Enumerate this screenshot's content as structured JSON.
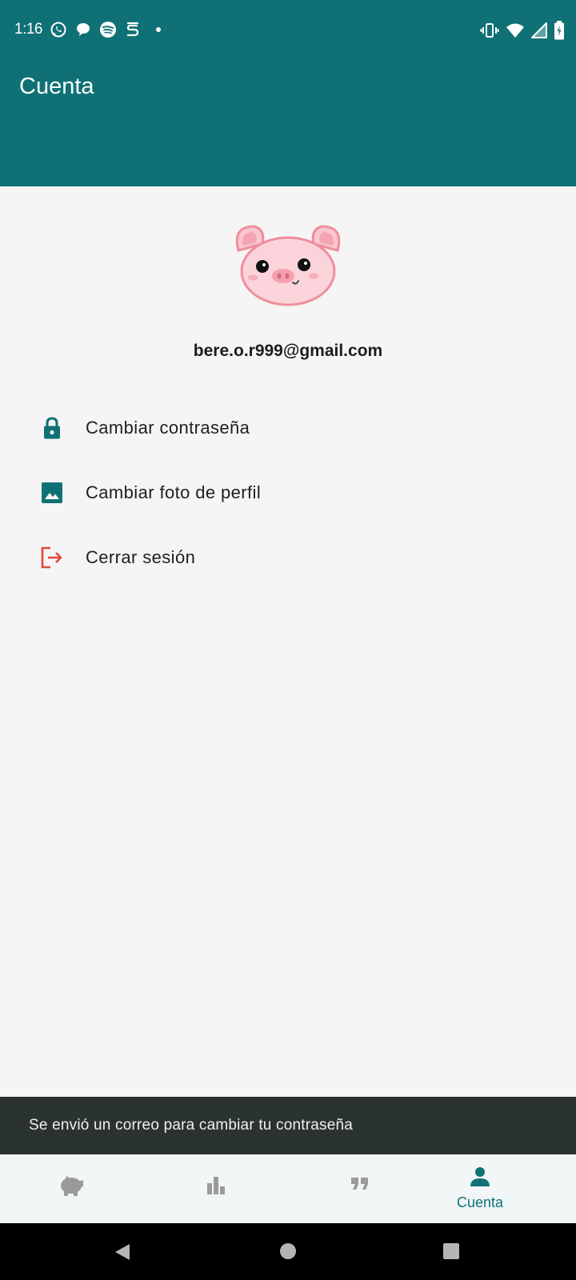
{
  "status_bar": {
    "time": "1:16",
    "left_icons": [
      "whatsapp-icon",
      "chat-bubble-icon",
      "spotify-icon",
      "s-app-icon",
      "dot-icon"
    ],
    "right_icons": [
      "vibrate-icon",
      "wifi-icon",
      "signal-icon",
      "battery-icon"
    ]
  },
  "app_bar": {
    "title": "Cuenta"
  },
  "profile": {
    "avatar_icon": "pig-avatar-icon",
    "email": "bere.o.r999@gmail.com"
  },
  "menu": {
    "items": [
      {
        "label": "Cambiar contraseña",
        "icon": "lock-icon"
      },
      {
        "label": "Cambiar foto de perfil",
        "icon": "image-icon"
      },
      {
        "label": "Cerrar sesión",
        "icon": "logout-icon"
      }
    ]
  },
  "snackbar": {
    "message": "Se envió un correo para cambiar tu contraseña"
  },
  "bottom_nav": {
    "items": [
      {
        "icon": "piggy-bank-icon",
        "label": ""
      },
      {
        "icon": "bar-chart-icon",
        "label": ""
      },
      {
        "icon": "quote-icon",
        "label": ""
      },
      {
        "icon": "person-icon",
        "label": "Cuenta",
        "selected": true
      }
    ]
  },
  "colors": {
    "primary": "#0f7175",
    "background": "#f5f5f5",
    "logout_red": "#e0483e",
    "snackbar_bg": "#2b3331",
    "nav_inactive": "#9a9a9a"
  }
}
